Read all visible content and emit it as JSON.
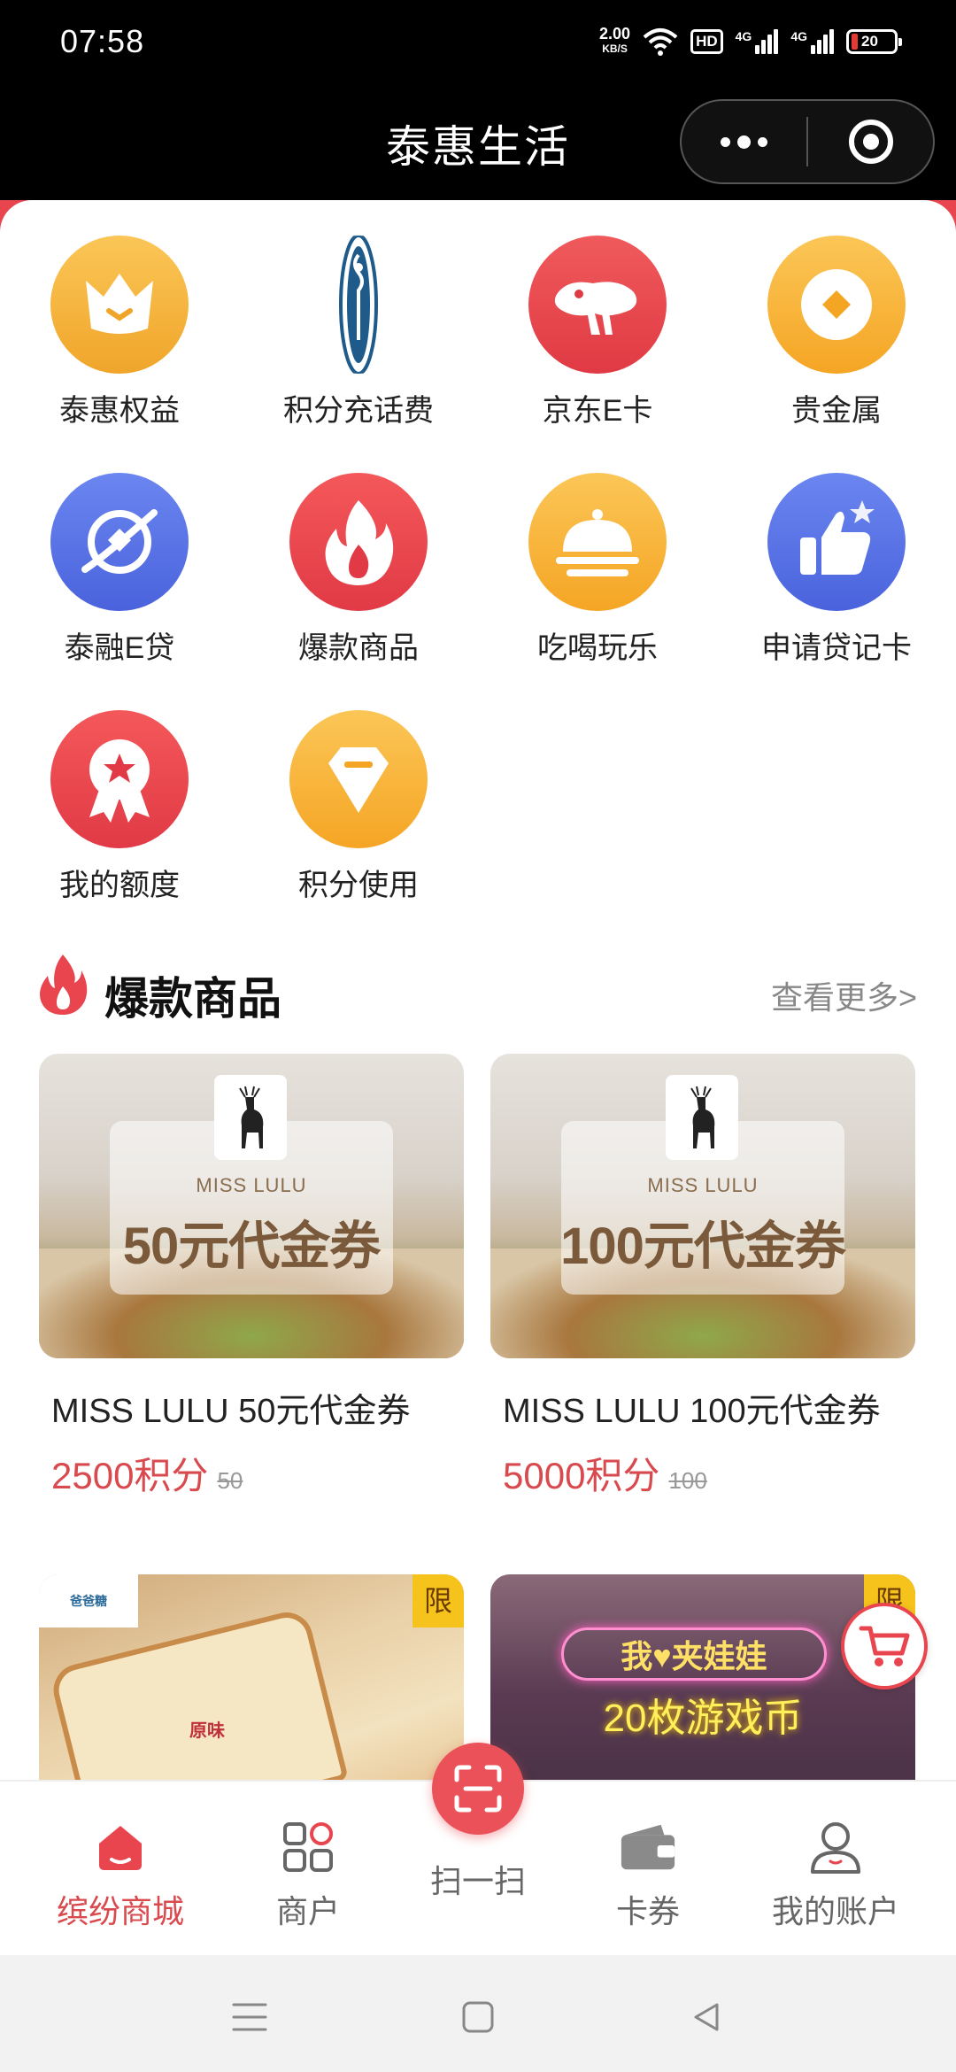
{
  "status_bar": {
    "time": "07:58",
    "net_speed_value": "2.00",
    "net_speed_unit": "KB/S",
    "hd_label": "HD",
    "signal1_tag": "4G",
    "signal2_tag": "4G",
    "battery_level": "20"
  },
  "header": {
    "title": "泰惠生活"
  },
  "grid": [
    {
      "label": "泰惠权益",
      "icon": "crown-icon",
      "color": "#f5b43c"
    },
    {
      "label": "积分充话费",
      "icon": "bank-logo-icon",
      "color": "#1e5a8a"
    },
    {
      "label": "京东E卡",
      "icon": "jd-dog-icon",
      "color": "#e8454f"
    },
    {
      "label": "贵金属",
      "icon": "coin-icon",
      "color": "#f7b12d"
    },
    {
      "label": "泰融E贷",
      "icon": "planet-icon",
      "color": "#5a72e6"
    },
    {
      "label": "爆款商品",
      "icon": "fire-icon",
      "color": "#ec4d51"
    },
    {
      "label": "吃喝玩乐",
      "icon": "dish-cover-icon",
      "color": "#f7b12d"
    },
    {
      "label": "申请贷记卡",
      "icon": "thumbs-up-icon",
      "color": "#5a72e6"
    },
    {
      "label": "我的额度",
      "icon": "medal-icon",
      "color": "#ec4d51"
    },
    {
      "label": "积分使用",
      "icon": "diamond-icon",
      "color": "#f7b12d"
    }
  ],
  "hot_section": {
    "title": "爆款商品",
    "more_label": "查看更多>"
  },
  "products": [
    {
      "title": "MISS LULU 50元代金券",
      "points": "2500积分",
      "old_price": "50",
      "brand": "MISS LULU",
      "amount_text": "50元代金券"
    },
    {
      "title": "MISS LULU 100元代金券",
      "points": "5000积分",
      "old_price": "100",
      "brand": "MISS LULU",
      "amount_text": "100元代金券"
    }
  ],
  "more_products": [
    {
      "badge": "限",
      "logo_text": "爸爸糖",
      "stamp": "原味"
    },
    {
      "badge": "限",
      "sign_text": "我♥夹娃娃",
      "caption": "20枚游戏币"
    }
  ],
  "tabbar": {
    "tabs": [
      {
        "label": "缤纷商城",
        "icon": "home-icon",
        "active": true
      },
      {
        "label": "商户",
        "icon": "apps-icon",
        "active": false
      },
      {
        "label": "扫一扫",
        "icon": "scan-icon",
        "active": false
      },
      {
        "label": "卡券",
        "icon": "wallet-icon",
        "active": false
      },
      {
        "label": "我的账户",
        "icon": "user-icon",
        "active": false
      }
    ],
    "active_color": "#d94a4f"
  },
  "colors": {
    "brand_red": "#e8454f",
    "price_red": "#d94a4f"
  }
}
